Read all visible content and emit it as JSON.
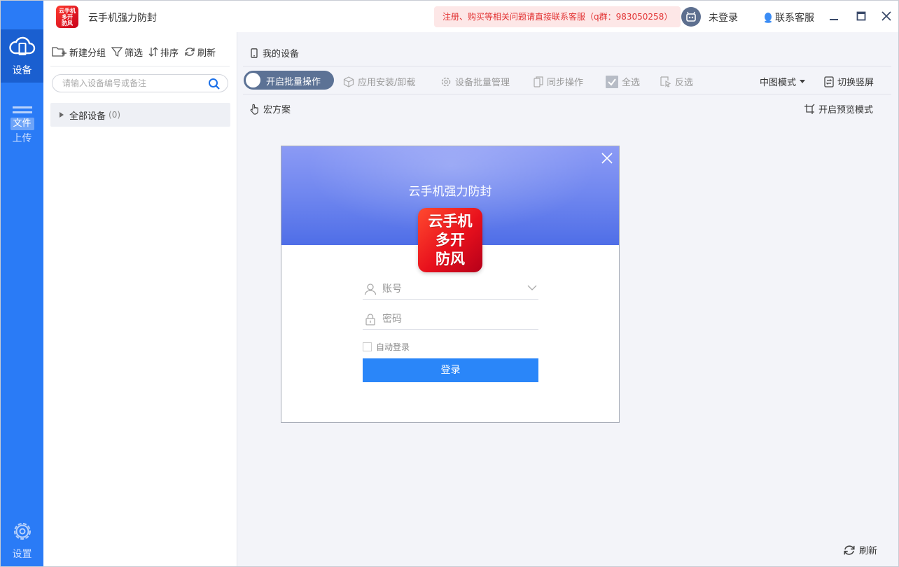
{
  "window": {
    "title": "云手机强力防封",
    "logo_text": "云手机多开防风",
    "notice": "注册、购买等相关问题请直接联系客服（q群：983050258）",
    "login_state": "未登录",
    "customer_service": "联系客服"
  },
  "nav": {
    "devices": "设备",
    "file": "文件",
    "upload": "上传",
    "settings": "设置"
  },
  "groups": {
    "new_group": "新建分组",
    "filter": "筛选",
    "sort": "排序",
    "refresh": "刷新",
    "search_placeholder": "请输入设备编号或备注",
    "all_devices": "全部设备",
    "all_count": "(0)"
  },
  "main": {
    "breadcrumb": "我的设备",
    "batch_toggle": "开启批量操作",
    "app_install": "应用安装/卸载",
    "batch_manage": "设备批量管理",
    "sync_op": "同步操作",
    "select_all": "全选",
    "invert": "反选",
    "view_mode": "中图模式",
    "switch_screen": "切换竖屏",
    "macro": "宏方案",
    "preview_mode": "开启预览模式",
    "refresh": "刷新"
  },
  "login_dialog": {
    "title": "云手机强力防封",
    "logo_lines": [
      "云手机",
      "多开",
      "防风"
    ],
    "account_placeholder": "账号",
    "password_placeholder": "密码",
    "auto_login": "自动登录",
    "login_button": "登录"
  },
  "colors": {
    "nav_bg": "#2a7bf6",
    "nav_active": "#1a5fd0",
    "primary_button": "#2a86f9",
    "notice_text": "#e23333",
    "notice_bg": "#fde7e7",
    "toggle_bg": "#5c7295"
  }
}
